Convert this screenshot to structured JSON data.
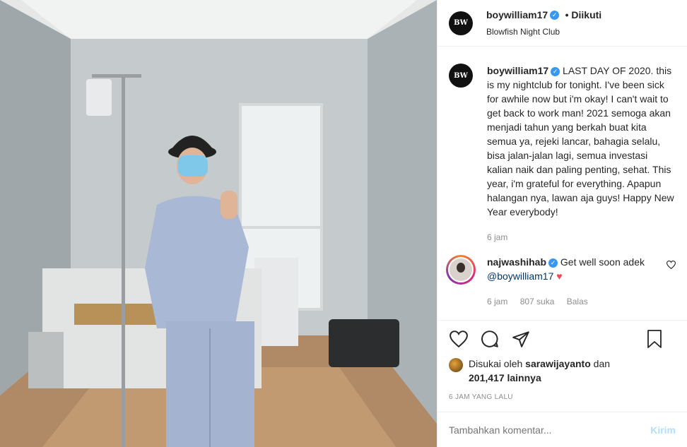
{
  "post": {
    "username": "boywilliam17",
    "follow_status": "• Diikuti",
    "location": "Blowfish Night Club",
    "avatar_text": "BW"
  },
  "caption": {
    "username": "boywilliam17",
    "text": "LAST DAY OF 2020. this is my nightclub for tonight. I've been sick for awhile now but i'm okay! I can't wait to get back to work man! 2021 semoga akan menjadi tahun yang berkah buat kita semua ya, rejeki lancar, bahagia selalu, bisa jalan-jalan lagi, semua investasi kalian naik dan paling penting, sehat. This year, i'm grateful for everything. Apapun halangan nya, lawan aja guys! Happy New Year everybody!",
    "time": "6 jam"
  },
  "comment": {
    "username": "najwashihab",
    "text": "Get well soon adek",
    "mention": "@boywilliam17",
    "emoji": "♥",
    "time": "6 jam",
    "likes": "807 suka",
    "reply": "Balas"
  },
  "likes": {
    "prefix": "Disukai oleh",
    "user": "sarawijayanto",
    "conj": "dan",
    "count": "201,417 lainnya"
  },
  "timestamp": "6 JAM YANG LALU",
  "add_comment": {
    "placeholder": "Tambahkan komentar...",
    "send": "Kirim"
  },
  "colors": {
    "verified": "#3897f0",
    "link": "#00376b",
    "heart": "#ed4956",
    "send_disabled": "#b2dffc"
  }
}
